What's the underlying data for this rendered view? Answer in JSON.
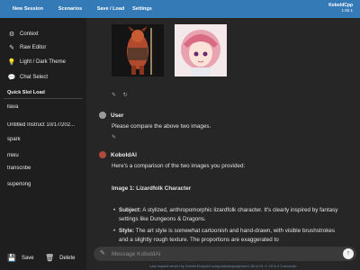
{
  "topbar": {
    "buttons": [
      "New Session",
      "Scenarios",
      "Save / Load",
      "Settings"
    ],
    "brand": "KoboldCpp",
    "version": "1.50.1"
  },
  "sidebar": {
    "menu": [
      {
        "icon": "gear-icon",
        "label": "Context"
      },
      {
        "icon": "edit-icon",
        "label": "Raw Editor"
      },
      {
        "icon": "lightbulb-icon",
        "label": "Light / Dark Theme"
      },
      {
        "icon": "chat-icon",
        "label": "Chat Select"
      }
    ],
    "quick_slot_title": "Quick Slot Load",
    "slots": [
      "llava",
      "Untitled Instruct 10/17/202...",
      "spark",
      "miku",
      "transcribe",
      "superlong"
    ],
    "save_label": "Save",
    "delete_label": "Delete"
  },
  "chat": {
    "user_name": "User",
    "user_message": "Please compare the above two images.",
    "ai_name": "KoboldAI",
    "ai_intro": "Here's a comparison of the two images you provided:",
    "ai_heading": "Image 1: Lizardfolk Character",
    "bullet1_label": "Subject:",
    "bullet1_text": "A stylized, anthropomorphic lizardfolk character. It's clearly inspired by fantasy settings like Dungeons & Dragons.",
    "bullet2_label": "Style:",
    "bullet2_text": "The art style is somewhat cartoonish and hand-drawn, with visible brushstrokes and a slightly rough texture. The proportions are exaggerated to"
  },
  "input": {
    "placeholder": "Message KoboldAI"
  },
  "footer": "Last request served by Gemini Endpoint using koboldcpp/gemini-1.5b in 04 :0 :15 in 2.3 seconds."
}
